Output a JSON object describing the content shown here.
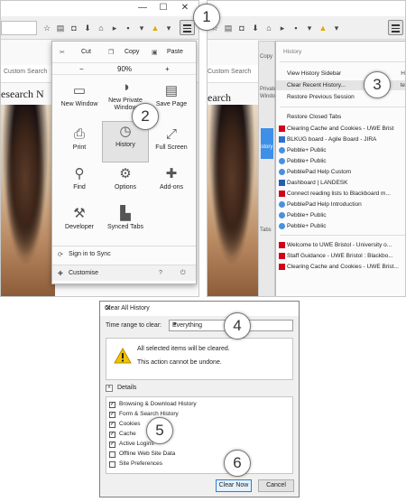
{
  "left": {
    "search_placeholder": "Custom Search",
    "site_title": "esearch  N",
    "edit": {
      "cut": "Cut",
      "copy": "Copy",
      "paste": "Paste"
    },
    "zoom": {
      "minus": "−",
      "level": "90%",
      "plus": "+"
    },
    "items": [
      {
        "label": "New Window",
        "icon": "window-icon"
      },
      {
        "label": "New Private Window",
        "icon": "mask-icon"
      },
      {
        "label": "Save Page",
        "icon": "save-page-icon"
      },
      {
        "label": "Print",
        "icon": "print-icon"
      },
      {
        "label": "History",
        "icon": "clock-icon"
      },
      {
        "label": "Full Screen",
        "icon": "fullscreen-icon"
      },
      {
        "label": "Find",
        "icon": "magnifier-icon"
      },
      {
        "label": "Options",
        "icon": "gear-icon"
      },
      {
        "label": "Add-ons",
        "icon": "puzzle-icon"
      },
      {
        "label": "Developer",
        "icon": "wrench-icon"
      },
      {
        "label": "Synced Tabs",
        "icon": "synced-tabs-icon"
      }
    ],
    "sign_in": "Sign in to Sync",
    "customise": "Customise"
  },
  "right": {
    "search_placeholder": "Custom Search",
    "site_title": "earch",
    "side_labels": [
      "Copy",
      "Private",
      "Window",
      "istory",
      "Tabs"
    ],
    "history_title": "History",
    "view_sidebar": "View History Sidebar",
    "view_sidebar_key": "H",
    "clear_recent": "Clear Recent History...",
    "clear_recent_key": "te",
    "restore_previous": "Restore Previous Session",
    "restore_closed": "Restore Closed Tabs",
    "entries": [
      "Clearing Cache and Cookies - UWE Brist",
      "BLKUG board - Agile Board - JIRA",
      "Pebble+ Public",
      "Pebble+ Public",
      "PebblePad Help Custom",
      "Dashboard | LANDESK",
      "Connect reading lists to Blackboard m...",
      "PebblePad Help Introduction",
      "Pebble+ Public",
      "Pebble+ Public"
    ],
    "entries2": [
      "Welcome to UWE Bristol - University o...",
      "Staff Guidance - UWE Bristol : Blackbo...",
      "Clearing Cache and Cookies - UWE Brist..."
    ]
  },
  "dialog": {
    "title": "Clear All History",
    "time_range_label": "Time range to clear:",
    "time_range_value": "Everything",
    "warning_line1": "All selected items will be cleared.",
    "warning_line2": "This action cannot be undone.",
    "details_label": "Details",
    "checkboxes": [
      {
        "label": "Browsing & Download History",
        "checked": true
      },
      {
        "label": "Form & Search History",
        "checked": true
      },
      {
        "label": "Cookies",
        "checked": true
      },
      {
        "label": "Cache",
        "checked": true
      },
      {
        "label": "Active Logins",
        "checked": true
      },
      {
        "label": "Offline Web Site Data",
        "checked": false
      },
      {
        "label": "Site Preferences",
        "checked": false
      }
    ],
    "clear_now": "Clear Now",
    "cancel": "Cancel"
  },
  "callouts": [
    "1",
    "2",
    "3",
    "4",
    "5",
    "6"
  ],
  "colors": {
    "accent": "#2b7fd3",
    "warning": "#f2c200",
    "favicon_red": "#d0021b"
  }
}
